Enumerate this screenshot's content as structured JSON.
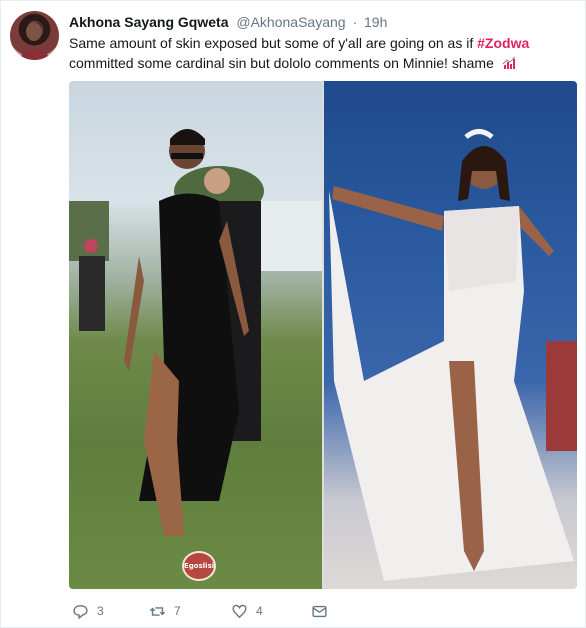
{
  "tweet": {
    "display_name": "Akhona Sayang Gqweta",
    "handle": "@AkhonaSayang",
    "separator": "·",
    "time": "19h",
    "text_part1": "Same amount of skin exposed but some of y'all are going on as if ",
    "hashtag": "#Zodwa",
    "text_part2": " committed some cardinal sin but dololo comments on Minnie! shame",
    "emoji_icon": "chart-emoji-icon"
  },
  "media": {
    "watermark_text": "Egoslisi"
  },
  "actions": {
    "reply_count": "3",
    "retweet_count": "7",
    "like_count": "4"
  },
  "colors": {
    "hashtag": "#e0245e",
    "meta": "#657786",
    "text": "#14171a"
  }
}
